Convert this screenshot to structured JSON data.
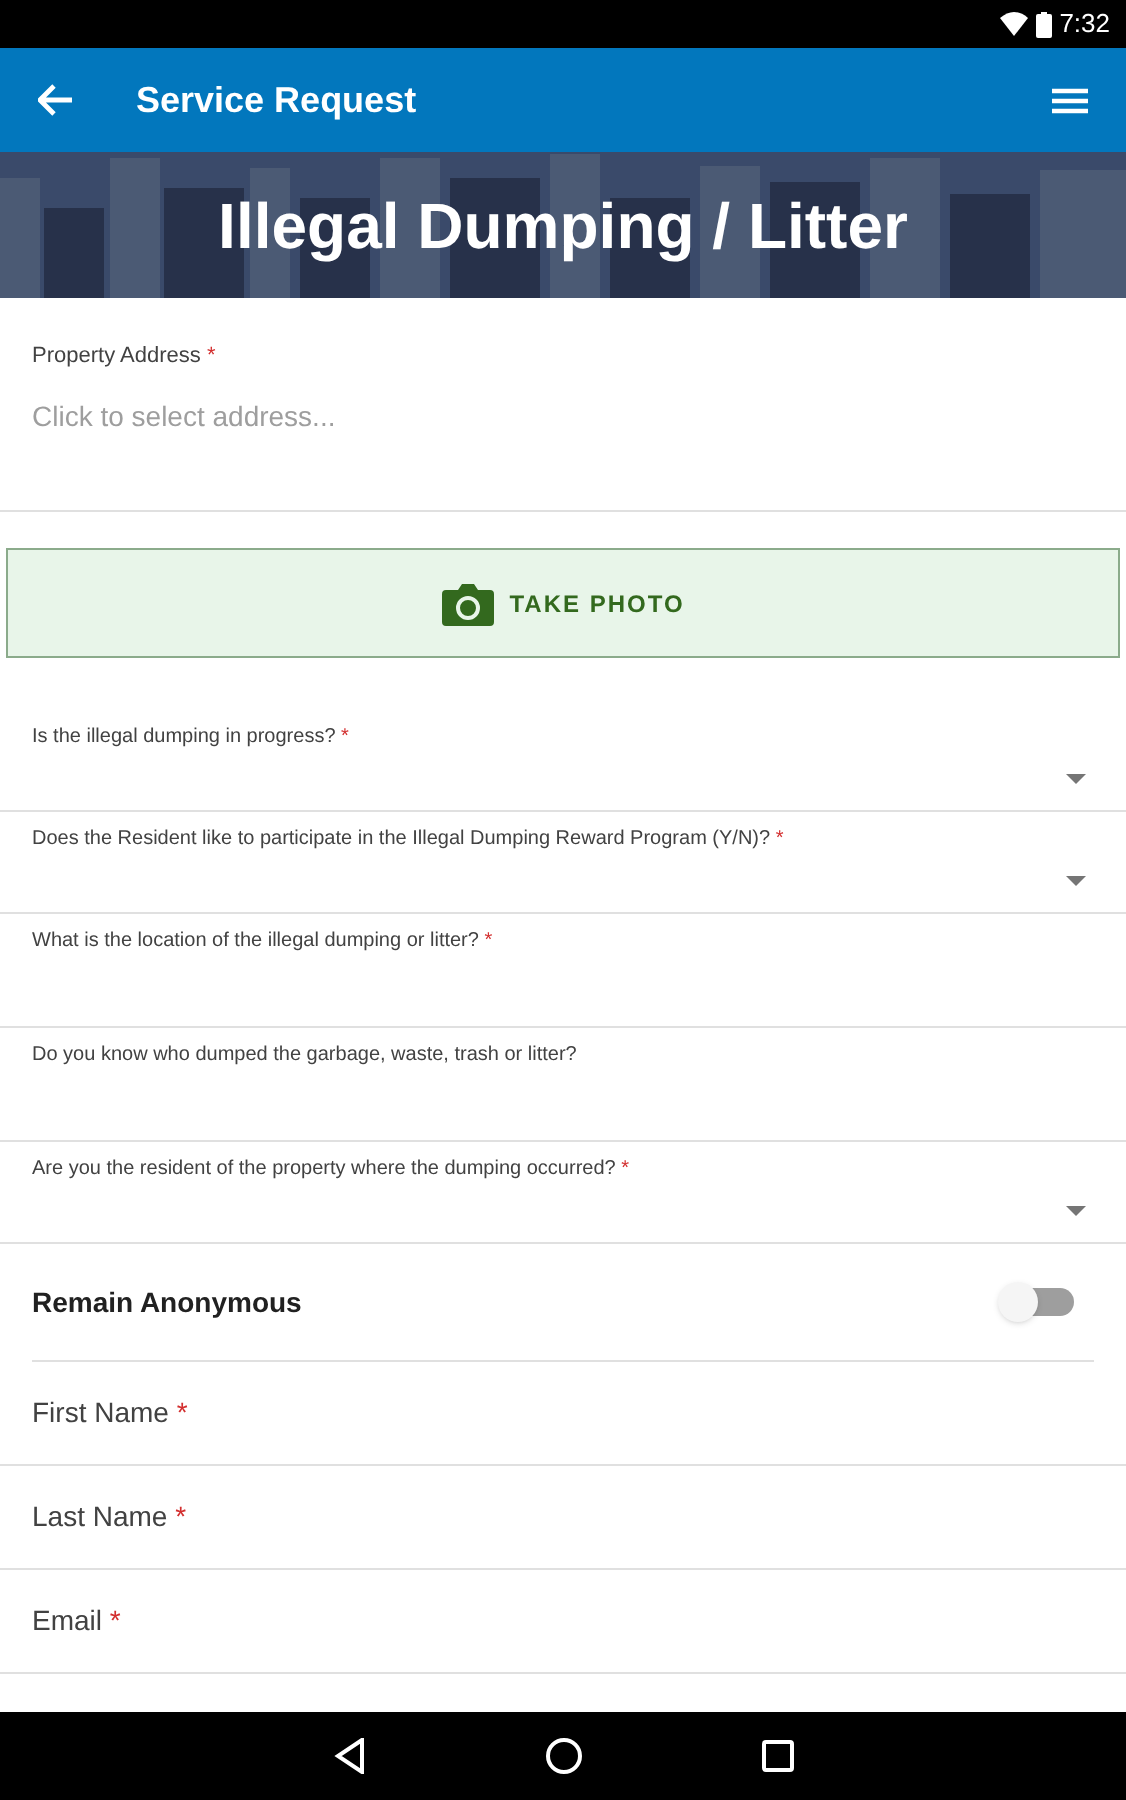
{
  "status_bar": {
    "time": "7:32"
  },
  "app_bar": {
    "title": "Service Request"
  },
  "banner": {
    "title": "Illegal Dumping / Litter"
  },
  "address": {
    "label": "Property Address",
    "required_mark": "*",
    "placeholder": "Click to select address..."
  },
  "photo_button": {
    "label": "TAKE PHOTO"
  },
  "questions": [
    {
      "kind": "dropdown",
      "label": "Is the illegal dumping in progress?",
      "required_mark": "*"
    },
    {
      "kind": "dropdown",
      "label": "Does the Resident like to participate in the Illegal Dumping Reward Program (Y/N)?",
      "required_mark": "*"
    },
    {
      "kind": "text",
      "label": "What is the location of the illegal dumping or litter?",
      "required_mark": "*"
    },
    {
      "kind": "text",
      "label": "Do you know who dumped the garbage, waste, trash or litter?"
    },
    {
      "kind": "dropdown",
      "label": "Are you the resident of the property where the dumping occurred?",
      "required_mark": "*"
    }
  ],
  "anonymous": {
    "label": "Remain Anonymous",
    "on": false
  },
  "contact_fields": [
    {
      "label": "First Name",
      "required_mark": "*"
    },
    {
      "label": "Last Name",
      "required_mark": "*"
    },
    {
      "label": "Email",
      "required_mark": "*"
    }
  ]
}
